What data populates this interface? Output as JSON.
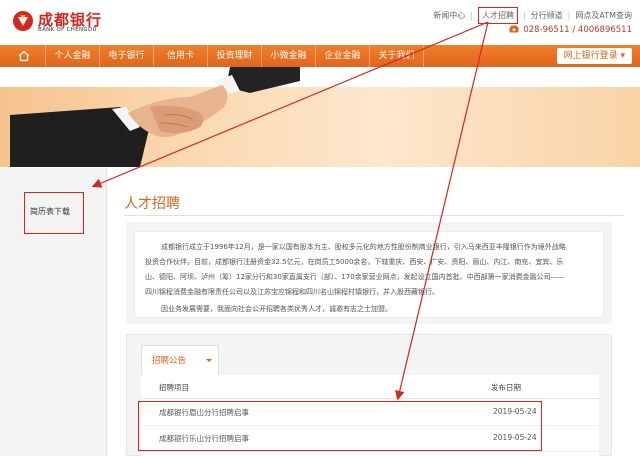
{
  "header": {
    "logo_cn": "成都银行",
    "logo_en": "BANK OF CHENGDU",
    "top_links": [
      "新闻中心",
      "人才招聘",
      "分行频道",
      "网点及ATM查询"
    ],
    "phone": "028-96511 / 4006896511"
  },
  "nav": {
    "items": [
      "个人金融",
      "电子银行",
      "信用卡",
      "投资理财",
      "小微金融",
      "企业金融",
      "关于我们"
    ],
    "bank_login": "网上银行登录 ▾"
  },
  "sidebar": {
    "item": "简历表下载"
  },
  "main": {
    "title": "人才招聘",
    "intro_lines": [
      "成都银行成立于1996年12月，是一家以国有股本为主、股权多元化的地方性股份制商业银行，引入马来西亚丰隆银行作为境外战略",
      "投资合作伙伴。目前，成都银行注册资金32.5亿元，在岗员工5000余名，下辖重庆、西安、广安、资阳、眉山、内江、南充、宜宾、乐",
      "山、德阳、阿坝、泸州（筹）12家分行和30家直属支行（部）、170余家营业网点，发起设立国内首批、中西部第一家消费金融公司——",
      "四川锦程消费金融有限责任公司以及江苏宝应锦程和四川名山锦程村镇银行，并入股西藏银行。"
    ],
    "intro_para2": "因业务发展需要，我面向社会公开招聘各类优秀人才，诚邀有志之士加盟。",
    "tab_label": "招聘公告",
    "col_item": "招聘项目",
    "col_date": "发布日期",
    "rows": [
      {
        "title": "成都银行眉山分行招聘启事",
        "date": "2019-05-24"
      },
      {
        "title": "成都银行乐山分行招聘启事",
        "date": "2019-05-24"
      }
    ]
  },
  "colors": {
    "brand_red": "#d9251c",
    "nav_orange": "#e0651b",
    "annotation_red": "#d9251c"
  }
}
